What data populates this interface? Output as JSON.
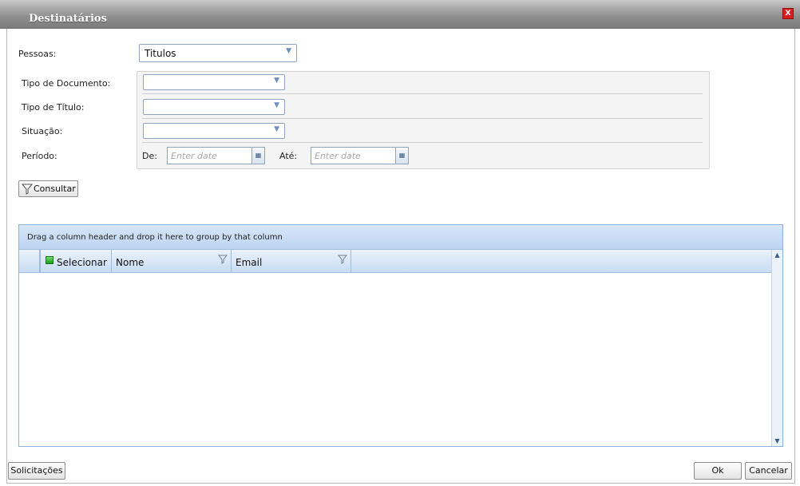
{
  "window": {
    "title": "Destinatários",
    "close_label": "X"
  },
  "form": {
    "pessoas": {
      "label": "Pessoas:",
      "value": "Titulos"
    },
    "tipo_documento": {
      "label": "Tipo de Documento:",
      "value": ""
    },
    "tipo_titulo": {
      "label": "Tipo de Título:",
      "value": ""
    },
    "situacao": {
      "label": "Situação:",
      "value": ""
    },
    "periodo": {
      "label": "Período:",
      "from_label": "De:",
      "from_placeholder": "Enter date",
      "to_label": "Até:",
      "to_placeholder": "Enter date"
    },
    "consultar_label": "Consultar"
  },
  "grid": {
    "group_panel_text": "Drag a column header and drop it here to group by that column",
    "columns": [
      "Selecionar",
      "Nome",
      "Email"
    ],
    "rows": []
  },
  "footer": {
    "solicitacoes_label": "Solicitações",
    "ok_label": "Ok",
    "cancelar_label": "Cancelar"
  },
  "icons": {
    "arrow": "▼",
    "calendar": "▦",
    "scroll_up": "▲",
    "scroll_down": "▼"
  }
}
